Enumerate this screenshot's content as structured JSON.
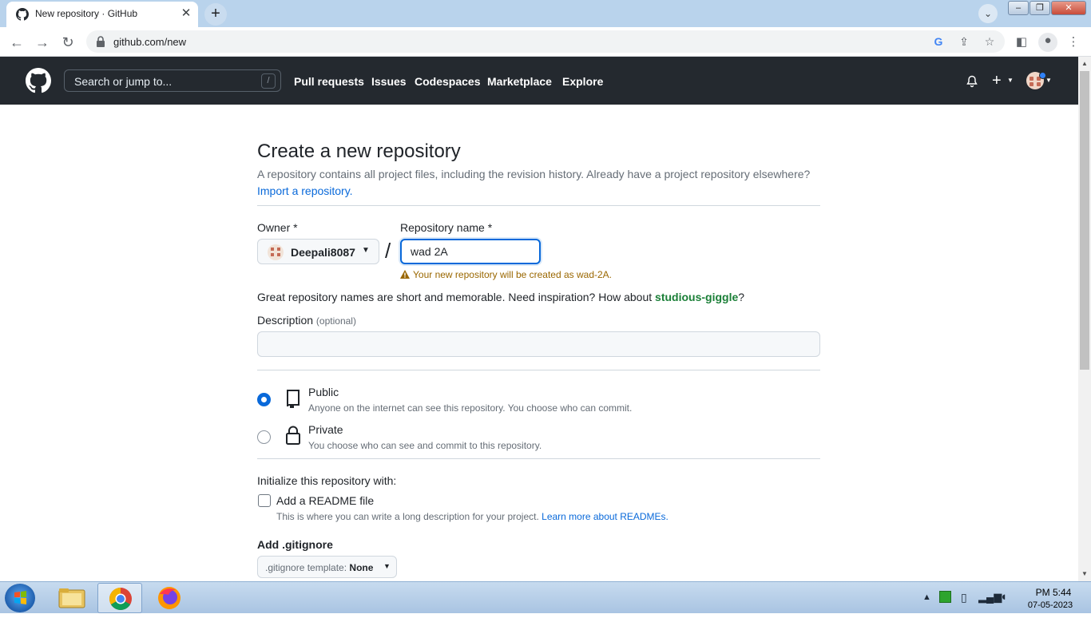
{
  "browser": {
    "tab_title": "New repository · GitHub",
    "tab_close": "✕",
    "new_tab": "+",
    "url": "github.com/new"
  },
  "github_header": {
    "search_placeholder": "Search or jump to...",
    "search_shortcut": "/",
    "nav": [
      "Pull requests",
      "Issues",
      "Codespaces",
      "Marketplace",
      "Explore"
    ]
  },
  "page": {
    "title": "Create a new repository",
    "subtitle": "A repository contains all project files, including the revision history. Already have a project repository elsewhere?",
    "import_link": "Import a repository.",
    "owner_label": "Owner *",
    "owner_value": "Deepali8087",
    "separator": "/",
    "repo_label": "Repository name *",
    "repo_value": "wad 2A",
    "warning": "Your new repository will be created as wad-2A.",
    "suggestion_prefix": "Great repository names are short and memorable. Need inspiration? How about ",
    "suggestion_name": "studious-giggle",
    "suggestion_suffix": "?",
    "description_label": "Description",
    "description_optional": "(optional)",
    "visibility": [
      {
        "title": "Public",
        "desc": "Anyone on the internet can see this repository. You choose who can commit.",
        "selected": true
      },
      {
        "title": "Private",
        "desc": "You choose who can see and commit to this repository.",
        "selected": false
      }
    ],
    "init_label": "Initialize this repository with:",
    "readme_title": "Add a README file",
    "readme_desc": "This is where you can write a long description for your project. ",
    "readme_link": "Learn more about READMEs.",
    "gitignore_label": "Add .gitignore",
    "gitignore_prefix": ".gitignore template: ",
    "gitignore_value": "None"
  },
  "taskbar": {
    "time": "PM 5:44",
    "date": "07-05-2023"
  },
  "colors": {
    "github_header": "#24292f",
    "link": "#0969da",
    "warning": "#9a6700",
    "suggestion": "#1a7f37",
    "focus": "#0969da"
  }
}
